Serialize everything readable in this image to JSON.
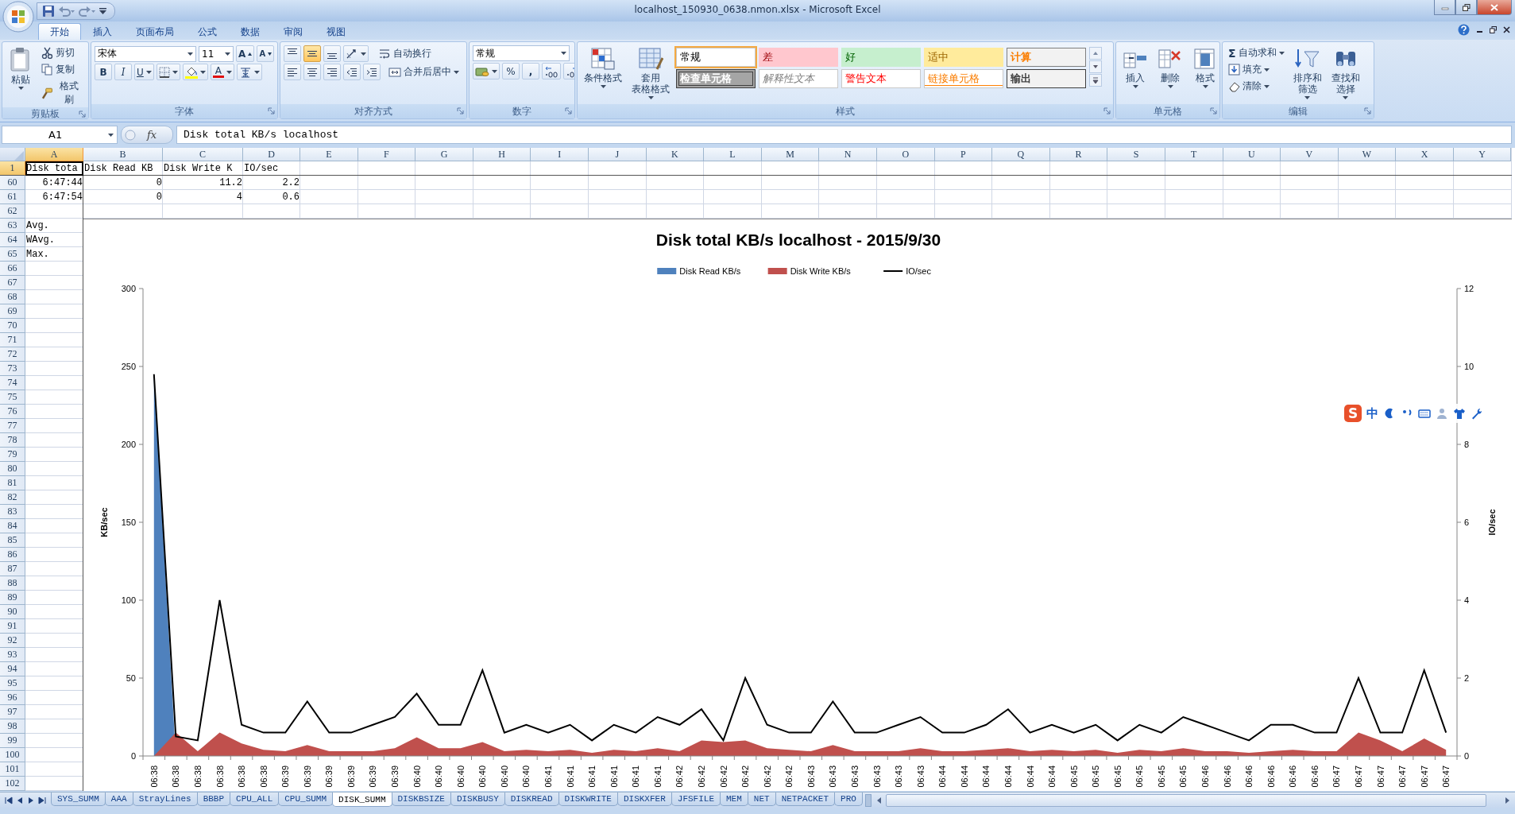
{
  "window": {
    "title": "localhost_150930_0638.nmon.xlsx - Microsoft Excel"
  },
  "ribbon_tabs": [
    {
      "label": "开始",
      "selected": true
    },
    {
      "label": "插入",
      "selected": false
    },
    {
      "label": "页面布局",
      "selected": false
    },
    {
      "label": "公式",
      "selected": false
    },
    {
      "label": "数据",
      "selected": false
    },
    {
      "label": "审阅",
      "selected": false
    },
    {
      "label": "视图",
      "selected": false
    }
  ],
  "ribbon": {
    "groups": [
      {
        "kind": "clipboard",
        "label": "剪贴板",
        "paste": "粘贴",
        "commands": [
          "剪切",
          "复制",
          "格式刷"
        ]
      },
      {
        "kind": "font",
        "label": "字体",
        "font_name": "宋体",
        "font_size": "11",
        "grow": "A",
        "shrink": "A",
        "bold": "B",
        "italic": "I",
        "underline": "U",
        "font_color": "A"
      },
      {
        "kind": "alignment",
        "label": "对齐方式",
        "vertical_align": [
          {
            "selected": false
          },
          {
            "selected": true
          },
          {
            "selected": false
          }
        ],
        "wrap": "自动换行",
        "merge": "合并后居中"
      },
      {
        "kind": "number",
        "label": "数字",
        "format": "常规",
        "percent": "%",
        "comma": ","
      },
      {
        "kind": "styles",
        "label": "样式",
        "conditional": "条件格式",
        "table_format": [
          "套用",
          "表格格式"
        ],
        "cell_styles": [
          {
            "label": "常规",
            "kind": "normal",
            "selected": true
          },
          {
            "label": "差",
            "kind": "bad",
            "selected": false
          },
          {
            "label": "好",
            "kind": "good",
            "selected": false
          },
          {
            "label": "适中",
            "kind": "neutral",
            "selected": false
          },
          {
            "label": "计算",
            "kind": "calculation",
            "selected": false
          },
          {
            "label": "检查单元格",
            "kind": "check",
            "selected": false
          },
          {
            "label": "解释性文本",
            "kind": "explanatory",
            "selected": false
          },
          {
            "label": "警告文本",
            "kind": "warning",
            "selected": false
          },
          {
            "label": "链接单元格",
            "kind": "linked",
            "selected": false
          },
          {
            "label": "输出",
            "kind": "output",
            "selected": false
          }
        ]
      },
      {
        "kind": "cells",
        "label": "单元格",
        "commands": [
          "插入",
          "删除",
          "格式"
        ]
      },
      {
        "kind": "editing",
        "label": "编辑",
        "autosum_symbol": "Σ",
        "autosum": "自动求和",
        "fill": "填充",
        "clear": "清除",
        "sort": [
          "排序和",
          "筛选"
        ],
        "find": [
          "查找和",
          "选择"
        ]
      }
    ]
  },
  "formula_bar": {
    "name_box": "A1",
    "function_label": "fx",
    "formula": "Disk total KB/s localhost"
  },
  "sheet": {
    "columns": [
      {
        "label": "A",
        "selected": true
      },
      {
        "label": "B",
        "selected": false
      },
      {
        "label": "C",
        "selected": false
      },
      {
        "label": "D",
        "selected": false
      },
      {
        "label": "E",
        "selected": false
      },
      {
        "label": "F",
        "selected": false
      },
      {
        "label": "G",
        "selected": false
      },
      {
        "label": "H",
        "selected": false
      },
      {
        "label": "I",
        "selected": false
      },
      {
        "label": "J",
        "selected": false
      },
      {
        "label": "K",
        "selected": false
      },
      {
        "label": "L",
        "selected": false
      },
      {
        "label": "M",
        "selected": false
      },
      {
        "label": "N",
        "selected": false
      },
      {
        "label": "O",
        "selected": false
      },
      {
        "label": "P",
        "selected": false
      },
      {
        "label": "Q",
        "selected": false
      },
      {
        "label": "R",
        "selected": false
      },
      {
        "label": "S",
        "selected": false
      },
      {
        "label": "T",
        "selected": false
      },
      {
        "label": "U",
        "selected": false
      },
      {
        "label": "V",
        "selected": false
      },
      {
        "label": "W",
        "selected": false
      },
      {
        "label": "X",
        "selected": false
      },
      {
        "label": "Y",
        "selected": false
      }
    ],
    "rows": [
      {
        "header": "1",
        "selected": true,
        "kind": "text",
        "cells": [
          "Disk tota",
          "Disk Read KB",
          "Disk Write K",
          "IO/sec"
        ]
      },
      {
        "header": "60",
        "selected": false,
        "kind": "numbers",
        "cells": [
          "6:47:44",
          "0",
          "11.2",
          "2.2"
        ]
      },
      {
        "header": "61",
        "selected": false,
        "kind": "numbers",
        "cells": [
          "6:47:54",
          "0",
          "4",
          "0.6"
        ]
      },
      {
        "header": "62",
        "selected": false
      },
      {
        "header": "63",
        "selected": false,
        "kind": "text",
        "cells": [
          "Avg."
        ]
      },
      {
        "header": "64",
        "selected": false,
        "kind": "text",
        "cells": [
          "WAvg."
        ]
      },
      {
        "header": "65",
        "selected": false,
        "kind": "text",
        "cells": [
          "Max."
        ]
      },
      {
        "header": "66",
        "selected": false
      },
      {
        "header": "67",
        "selected": false
      },
      {
        "header": "68",
        "selected": false
      },
      {
        "header": "69",
        "selected": false
      },
      {
        "header": "70",
        "selected": false
      },
      {
        "header": "71",
        "selected": false
      },
      {
        "header": "72",
        "selected": false
      },
      {
        "header": "73",
        "selected": false
      },
      {
        "header": "74",
        "selected": false
      },
      {
        "header": "75",
        "selected": false
      },
      {
        "header": "76",
        "selected": false
      },
      {
        "header": "77",
        "selected": false
      },
      {
        "header": "78",
        "selected": false
      },
      {
        "header": "79",
        "selected": false
      },
      {
        "header": "80",
        "selected": false
      },
      {
        "header": "81",
        "selected": false
      },
      {
        "header": "82",
        "selected": false
      },
      {
        "header": "83",
        "selected": false
      },
      {
        "header": "84",
        "selected": false
      },
      {
        "header": "85",
        "selected": false
      },
      {
        "header": "86",
        "selected": false
      },
      {
        "header": "87",
        "selected": false
      },
      {
        "header": "88",
        "selected": false
      },
      {
        "header": "89",
        "selected": false
      },
      {
        "header": "90",
        "selected": false
      },
      {
        "header": "91",
        "selected": false
      },
      {
        "header": "92",
        "selected": false
      },
      {
        "header": "93",
        "selected": false
      },
      {
        "header": "94",
        "selected": false
      },
      {
        "header": "95",
        "selected": false
      },
      {
        "header": "96",
        "selected": false
      },
      {
        "header": "97",
        "selected": false
      },
      {
        "header": "98",
        "selected": false
      },
      {
        "header": "99",
        "selected": false
      },
      {
        "header": "100",
        "selected": false
      },
      {
        "header": "101",
        "selected": false
      },
      {
        "header": "102",
        "selected": false
      }
    ],
    "chart": {
      "chart_data": {
        "type": "area",
        "title": "Disk total KB/s localhost - 2015/9/30",
        "legend": "top",
        "ylabel": "KB/sec",
        "y2label": "IO/sec",
        "ylim": [
          0,
          300
        ],
        "y2lim": [
          0,
          12
        ],
        "yticks": [
          0,
          50,
          100,
          150,
          200,
          250,
          300
        ],
        "y2ticks": [
          0,
          2,
          4,
          6,
          8,
          10,
          12
        ],
        "categories": [
          "06:38",
          "06:38",
          "06:38",
          "06:38",
          "06:38",
          "06:38",
          "06:39",
          "06:39",
          "06:39",
          "06:39",
          "06:39",
          "06:39",
          "06:40",
          "06:40",
          "06:40",
          "06:40",
          "06:40",
          "06:40",
          "06:41",
          "06:41",
          "06:41",
          "06:41",
          "06:41",
          "06:41",
          "06:42",
          "06:42",
          "06:42",
          "06:42",
          "06:42",
          "06:42",
          "06:43",
          "06:43",
          "06:43",
          "06:43",
          "06:43",
          "06:43",
          "06:44",
          "06:44",
          "06:44",
          "06:44",
          "06:44",
          "06:44",
          "06:45",
          "06:45",
          "06:45",
          "06:45",
          "06:45",
          "06:45",
          "06:46",
          "06:46",
          "06:46",
          "06:46",
          "06:46",
          "06:46",
          "06:47",
          "06:47",
          "06:47",
          "06:47",
          "06:47",
          "06:47"
        ],
        "series": [
          {
            "name": "Disk Read KB/s",
            "color": "#4f81bd",
            "values": [
              245,
              0,
              0,
              0,
              0,
              0,
              0,
              0,
              0,
              0,
              0,
              0,
              0,
              0,
              0,
              0,
              0,
              0,
              0,
              0,
              0,
              0,
              0,
              0,
              0,
              0,
              0,
              0,
              0,
              0,
              0,
              0,
              0,
              0,
              0,
              0,
              0,
              0,
              0,
              0,
              0,
              0,
              0,
              0,
              0,
              0,
              0,
              0,
              0,
              0,
              0,
              0,
              0,
              0,
              0,
              0,
              0,
              0,
              0,
              0
            ]
          },
          {
            "name": "Disk Write KB/s",
            "color": "#c0504d",
            "values": [
              0,
              15,
              3,
              15,
              8,
              4,
              3,
              7,
              3,
              3,
              3,
              5,
              12,
              5,
              5,
              9,
              3,
              4,
              3,
              4,
              2,
              4,
              3,
              5,
              3,
              10,
              9,
              10,
              5,
              4,
              3,
              7,
              3,
              3,
              3,
              5,
              3,
              3,
              4,
              5,
              3,
              4,
              3,
              4,
              2,
              4,
              3,
              5,
              3,
              3,
              2,
              3,
              4,
              3,
              3,
              15,
              10,
              3,
              11.2,
              4
            ]
          },
          {
            "name": "IO/sec",
            "color": "#000000",
            "type": "line",
            "axis": "y2",
            "values": [
              9.8,
              0.5,
              0.4,
              4,
              0.8,
              0.6,
              0.6,
              1.4,
              0.6,
              0.6,
              0.8,
              1,
              1.6,
              0.8,
              0.8,
              2.2,
              0.6,
              0.8,
              0.6,
              0.8,
              0.4,
              0.8,
              0.6,
              1,
              0.8,
              1.2,
              0.4,
              2,
              0.8,
              0.6,
              0.6,
              1.4,
              0.6,
              0.6,
              0.8,
              1,
              0.6,
              0.6,
              0.8,
              1.2,
              0.6,
              0.8,
              0.6,
              0.8,
              0.4,
              0.8,
              0.6,
              1,
              0.8,
              0.6,
              0.4,
              0.8,
              0.8,
              0.6,
              0.6,
              2,
              0.6,
              0.6,
              2.2,
              0.6
            ]
          }
        ]
      }
    }
  },
  "ime_toolbar": {
    "logo": "S",
    "mode": "中"
  },
  "sheet_tabs": [
    {
      "label": "SYS_SUMM",
      "selected": false
    },
    {
      "label": "AAA",
      "selected": false
    },
    {
      "label": "StrayLines",
      "selected": false
    },
    {
      "label": "BBBP",
      "selected": false
    },
    {
      "label": "CPU_ALL",
      "selected": false
    },
    {
      "label": "CPU_SUMM",
      "selected": false
    },
    {
      "label": "DISK_SUMM",
      "selected": true
    },
    {
      "label": "DISKBSIZE",
      "selected": false
    },
    {
      "label": "DISKBUSY",
      "selected": false
    },
    {
      "label": "DISKREAD",
      "selected": false
    },
    {
      "label": "DISKWRITE",
      "selected": false
    },
    {
      "label": "DISKXFER",
      "selected": false
    },
    {
      "label": "JFSFILE",
      "selected": false
    },
    {
      "label": "MEM",
      "selected": false
    },
    {
      "label": "NET",
      "selected": false
    },
    {
      "label": "NETPACKET",
      "selected": false
    },
    {
      "label": "PRO",
      "selected": false
    }
  ]
}
